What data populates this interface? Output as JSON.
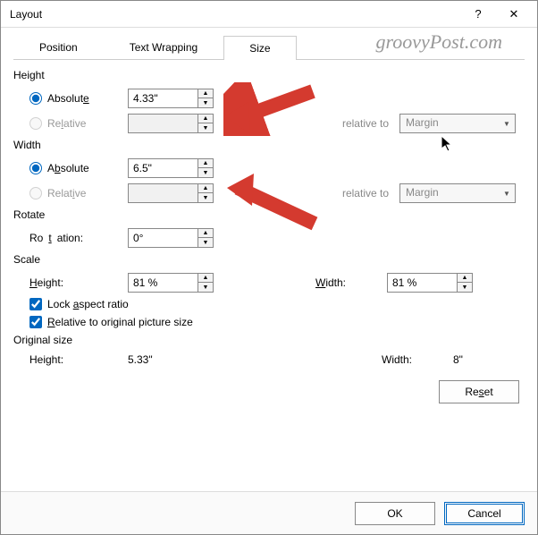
{
  "dialog": {
    "title": "Layout",
    "help": "?",
    "close": "✕"
  },
  "watermark": "groovyPost.com",
  "tabs": {
    "position": "Position",
    "textWrapping": "Text Wrapping",
    "size": "Size"
  },
  "height": {
    "section": "Height",
    "absolute_label": "Absolute",
    "absolute_value": "4.33\"",
    "relative_label": "Relative",
    "relative_value": "",
    "relative_to_label": "relative to",
    "relative_to_value": "Margin"
  },
  "width": {
    "section": "Width",
    "absolute_label": "Absolute",
    "absolute_value": "6.5\"",
    "relative_label": "Relative",
    "relative_value": "",
    "relative_to_label": "relative to",
    "relative_to_value": "Margin"
  },
  "rotate": {
    "section": "Rotate",
    "rotation_label": "Rotation:",
    "rotation_value": "0°"
  },
  "scale": {
    "section": "Scale",
    "height_label": "Height:",
    "height_value": "81 %",
    "width_label": "Width:",
    "width_value": "81 %",
    "lock_aspect": "Lock aspect ratio",
    "relative_original": "Relative to original picture size"
  },
  "original": {
    "section": "Original size",
    "height_label": "Height:",
    "height_value": "5.33\"",
    "width_label": "Width:",
    "width_value": "8\""
  },
  "buttons": {
    "reset": "Reset",
    "ok": "OK",
    "cancel": "Cancel"
  }
}
